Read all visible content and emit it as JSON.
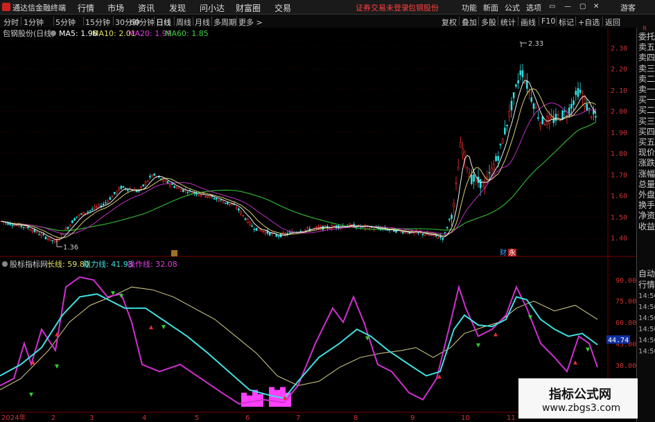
{
  "app_title": "通达信金融终端",
  "menu": [
    "行情",
    "市场",
    "资讯",
    "发现",
    "问小达",
    "财富圈",
    "交易"
  ],
  "trade_status": "证券交易未登录",
  "stock_name_top": "包钢股份",
  "menu_right": [
    "功能",
    "新面",
    "公式",
    "选项"
  ],
  "guest_label": "游客",
  "window_controls": [
    "▭",
    "—",
    "▢",
    "✕"
  ],
  "periods": [
    "分时",
    "1分钟",
    "5分钟",
    "15分钟",
    "30分钟",
    "60分钟",
    "日线",
    "周线",
    "月线",
    "多周期",
    "更多 >"
  ],
  "active_period": "日线",
  "tools": [
    "复权",
    "叠加",
    "多股",
    "统计",
    "画线",
    "F10",
    "标记",
    "+自选",
    "返回"
  ],
  "main_title": "包钢股份(日线)",
  "ma_legend": [
    {
      "label": "MA5: 1.96",
      "color": "#ffffff"
    },
    {
      "label": "MA10: 2.01",
      "color": "#e8e060"
    },
    {
      "label": "MA20: 1.99",
      "color": "#e040e0"
    },
    {
      "label": "MA60: 1.85",
      "color": "#40d040"
    }
  ],
  "high_label": "2.33",
  "low_label": "1.36",
  "event_marks": [
    "财",
    "永"
  ],
  "price_axis": [
    "2.30",
    "2.20",
    "2.10",
    "2.00",
    "1.90",
    "1.80",
    "1.70",
    "1.60",
    "1.50",
    "1.40"
  ],
  "price_axis_colors": [
    "#e03030",
    "#e03030",
    "#e03030",
    "#e03030",
    "#20c020",
    "#20c020",
    "#20c020",
    "#20c020",
    "#20c020",
    "#20c020"
  ],
  "indicator_name": "股标指标网",
  "indicator_legend": [
    {
      "label": "长线: 59.80",
      "color": "#e8e060"
    },
    {
      "label": "阻力线: 41.93",
      "color": "#40e0e0"
    },
    {
      "label": "操作线: 32.08",
      "color": "#e040e0"
    }
  ],
  "ind_axis": [
    "90.00",
    "75.00",
    "60.00",
    "45.00",
    "30.00"
  ],
  "ind_axis_right": [
    "14:50",
    "14:50",
    "14:50",
    "14:50",
    "14:50",
    "14:50"
  ],
  "current_value": "44.74",
  "date_axis": [
    "2024年",
    "2",
    "3",
    "4",
    "5",
    "6",
    "7",
    "8",
    "9",
    "10",
    "11"
  ],
  "right_panel_top": "R",
  "right_panel": [
    "委托",
    "卖五",
    "卖四",
    "卖三",
    "卖二",
    "卖一",
    "买一",
    "买二",
    "买三",
    "买四",
    "买五",
    "现价",
    "涨跌",
    "涨幅",
    "总量",
    "外盘",
    "换手",
    "净资",
    "收益"
  ],
  "right_panel_bottom": [
    "自动",
    "行情"
  ],
  "watermark_text": "指标公式网",
  "watermark_url": "www.zbgs3.com"
}
